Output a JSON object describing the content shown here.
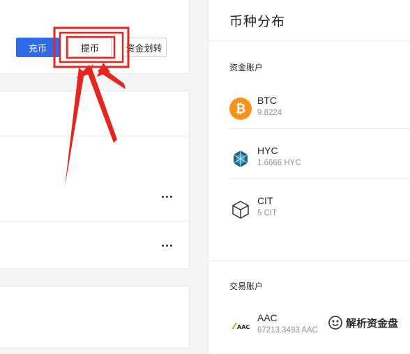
{
  "actions": {
    "deposit_label": "充币",
    "withdraw_label": "提币",
    "transfer_label": "资金划转"
  },
  "panel": {
    "title": "币种分布",
    "funding_section": "资金账户",
    "trading_section": "交易账户",
    "funding_assets": [
      {
        "symbol": "BTC",
        "amount": "9.8224",
        "icon": "bitcoin-icon"
      },
      {
        "symbol": "HYC",
        "amount": "1.6666 HYC",
        "icon": "hyc-icon"
      },
      {
        "symbol": "CIT",
        "amount": "5 CIT",
        "icon": "cube-icon"
      }
    ],
    "trading_assets": [
      {
        "symbol": "AAC",
        "amount": "67213.3493 AAC",
        "icon": "aac-icon"
      }
    ]
  },
  "watermark": {
    "text": "解析资金盘",
    "icon": "wechat-official-icon"
  },
  "colors": {
    "primary": "#2e6be6",
    "highlight": "#e5261f",
    "bitcoin": "#f7931a"
  }
}
